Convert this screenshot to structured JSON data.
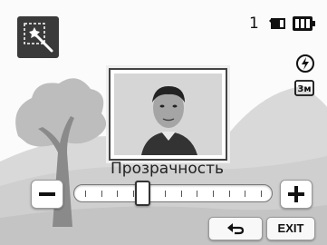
{
  "status": {
    "shot_count": "1",
    "card_icon": "memory-card-icon",
    "battery_icon": "battery-full-icon",
    "flash_icon": "flash-auto-icon",
    "size_icon": "size-3m-icon",
    "size_icon_text": "3м"
  },
  "mode": {
    "icon": "magic-wand-icon"
  },
  "photo": {
    "subject": "portrait-thumbnail"
  },
  "slider": {
    "label": "Прозрачность",
    "minus_icon": "minus-icon",
    "plus_icon": "plus-icon",
    "level_fraction": 0.33,
    "ticks": 12
  },
  "footer": {
    "back_icon": "back-arrow-icon",
    "exit_label": "EXIT"
  }
}
